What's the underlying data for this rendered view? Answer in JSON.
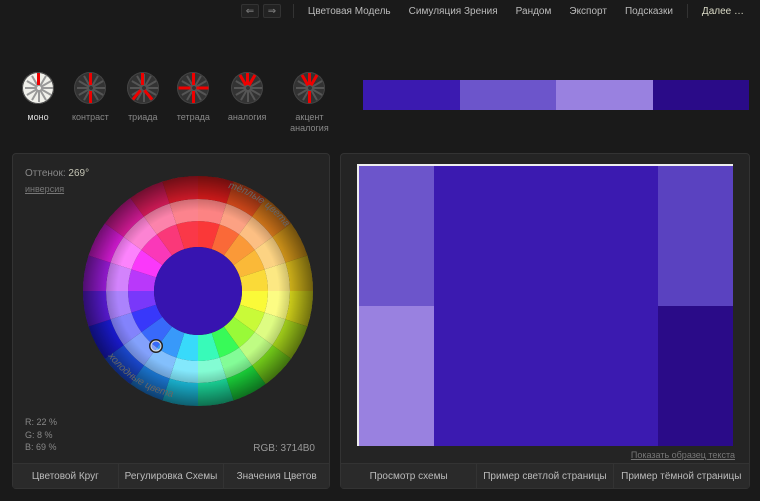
{
  "topbar": {
    "links": [
      "Цветовая Модель",
      "Симуляция Зрения",
      "Рандом",
      "Экспорт",
      "Подсказки"
    ],
    "more": "Далее …"
  },
  "modes": [
    {
      "label": "моно",
      "active": true
    },
    {
      "label": "контраст",
      "active": false
    },
    {
      "label": "триада",
      "active": false
    },
    {
      "label": "тетрада",
      "active": false
    },
    {
      "label": "аналогия",
      "active": false
    },
    {
      "label": "акцент аналогия",
      "active": false
    }
  ],
  "swatches": [
    "#3b1ab0",
    "#6c55cb",
    "#9981e0",
    "#2a0b88"
  ],
  "left": {
    "hue_label": "Оттенок:",
    "hue_value": "269°",
    "invert": "инверсия",
    "warm_curve": "тёплые цвета",
    "cold_curve": "холодные цвета",
    "rgb_pct": {
      "r": "R: 22 %",
      "g": "G:   8 %",
      "b": "B: 69 %"
    },
    "rgb_hex_label": "RGB:",
    "rgb_hex": "3714B0",
    "tabs": [
      "Цветовой Круг",
      "Регулировка Схемы",
      "Значения Цветов"
    ]
  },
  "right": {
    "sample_link": "Показать образец текста",
    "tabs": [
      "Просмотр схемы",
      "Пример светлой страницы",
      "Пример тёмной страницы"
    ]
  },
  "preview_grid": [
    {
      "col": "1",
      "row": "1",
      "bg": "#6c55cb"
    },
    {
      "col": "2",
      "row": "1 / 3",
      "bg": "#3b1ab0"
    },
    {
      "col": "3",
      "row": "1",
      "bg": "#5a42c0"
    },
    {
      "col": "1",
      "row": "2",
      "bg": "#9981e0"
    },
    {
      "col": "3",
      "row": "2",
      "bg": "#2a0b88"
    }
  ]
}
